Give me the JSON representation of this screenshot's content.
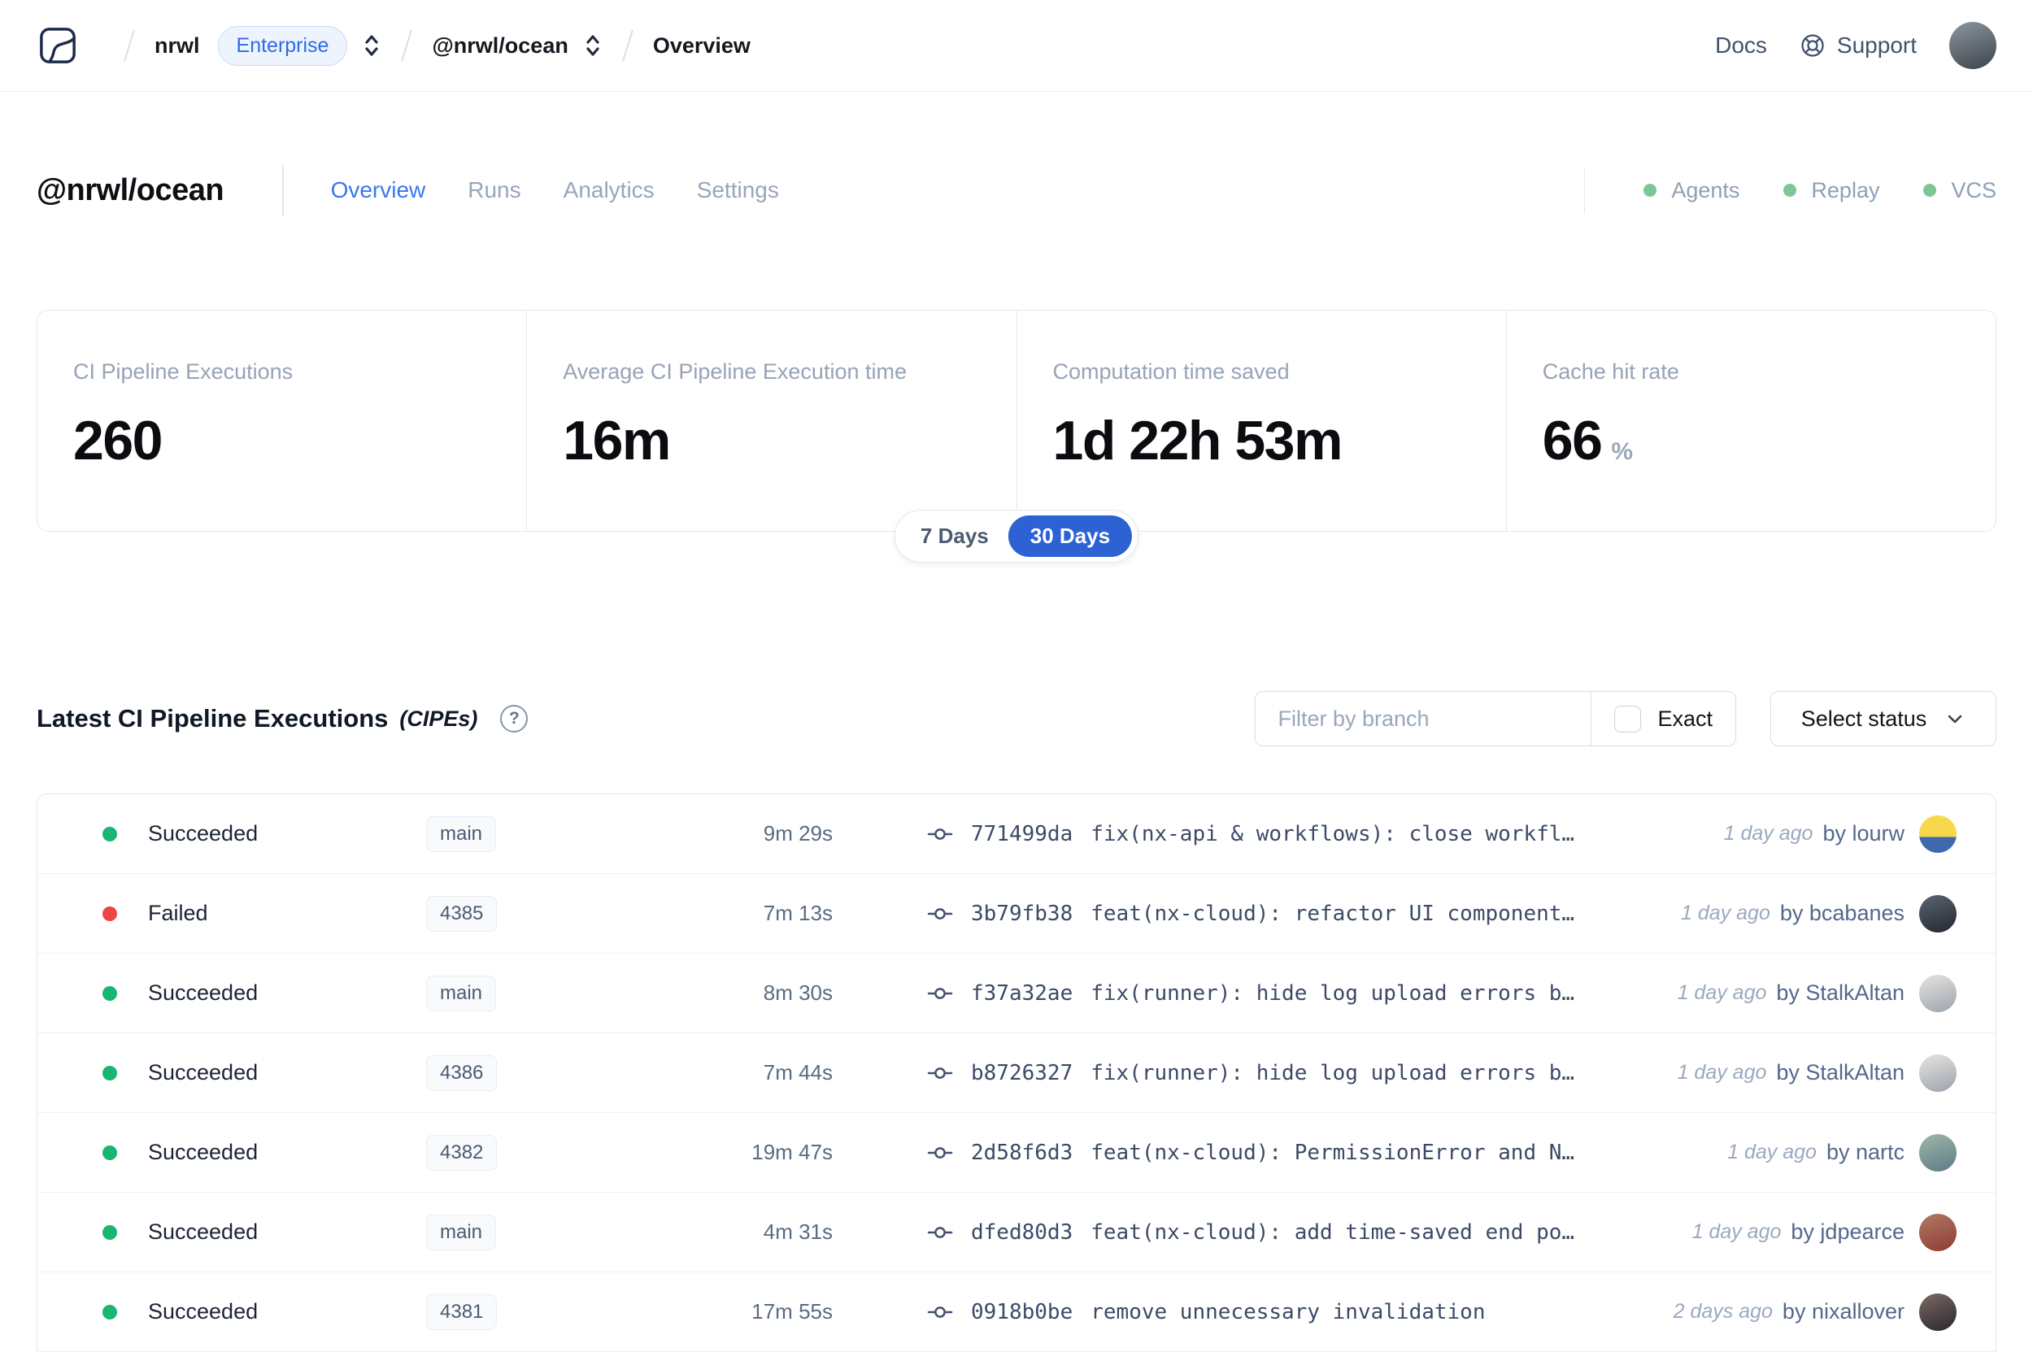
{
  "navbar": {
    "breadcrumb": {
      "org": "nrwl",
      "org_badge": "Enterprise",
      "workspace": "@nrwl/ocean",
      "page": "Overview"
    },
    "docs_label": "Docs",
    "support_label": "Support",
    "avatar_colors": [
      "#8d979f",
      "#3c434a"
    ]
  },
  "header": {
    "title": "@nrwl/ocean",
    "tabs": [
      {
        "label": "Overview",
        "active": true
      },
      {
        "label": "Runs",
        "active": false
      },
      {
        "label": "Analytics",
        "active": false
      },
      {
        "label": "Settings",
        "active": false
      }
    ],
    "integrations": [
      {
        "label": "Agents",
        "status": "online"
      },
      {
        "label": "Replay",
        "status": "online"
      },
      {
        "label": "VCS",
        "status": "online"
      }
    ]
  },
  "stats": {
    "cards": [
      {
        "label": "CI Pipeline Executions",
        "value": "260",
        "suffix": ""
      },
      {
        "label": "Average CI Pipeline Execution time",
        "value": "16m",
        "suffix": ""
      },
      {
        "label": "Computation time saved",
        "value": "1d 22h 53m",
        "suffix": ""
      },
      {
        "label": "Cache hit rate",
        "value": "66",
        "suffix": "%"
      }
    ],
    "range_options": [
      {
        "label": "7 Days",
        "selected": false
      },
      {
        "label": "30 Days",
        "selected": true
      }
    ]
  },
  "cipes": {
    "title": "Latest CI Pipeline Executions",
    "title_suffix": "(CIPEs)",
    "help_icon": "?",
    "filter_placeholder": "Filter by branch",
    "exact_label": "Exact",
    "exact_checked": false,
    "status_select_label": "Select status",
    "rows": [
      {
        "status": "Succeeded",
        "status_key": "succeeded",
        "branch": "main",
        "duration": "9m 29s",
        "commit_sha": "771499da",
        "commit_message": "fix(nx-api & workflows): close workfl…",
        "time_ago": "1 day ago",
        "author": "by lourw",
        "avatar_colors": [
          "#f7d84b",
          "#4068ae"
        ],
        "avatar_split": 58
      },
      {
        "status": "Failed",
        "status_key": "failed",
        "branch": "4385",
        "duration": "7m 13s",
        "commit_sha": "3b79fb38",
        "commit_message": "feat(nx-cloud): refactor UI component…",
        "time_ago": "1 day ago",
        "author": "by bcabanes",
        "avatar_colors": [
          "#5b6571",
          "#23272e"
        ],
        "avatar_split": null
      },
      {
        "status": "Succeeded",
        "status_key": "succeeded",
        "branch": "main",
        "duration": "8m 30s",
        "commit_sha": "f37a32ae",
        "commit_message": "fix(runner): hide log upload errors b…",
        "time_ago": "1 day ago",
        "author": "by StalkAltan",
        "avatar_colors": [
          "#e8e4e0",
          "#9aa4ad"
        ],
        "avatar_split": null
      },
      {
        "status": "Succeeded",
        "status_key": "succeeded",
        "branch": "4386",
        "duration": "7m 44s",
        "commit_sha": "b8726327",
        "commit_message": "fix(runner): hide log upload errors b…",
        "time_ago": "1 day ago",
        "author": "by StalkAltan",
        "avatar_colors": [
          "#e8e4e0",
          "#9aa4ad"
        ],
        "avatar_split": null
      },
      {
        "status": "Succeeded",
        "status_key": "succeeded",
        "branch": "4382",
        "duration": "19m 47s",
        "commit_sha": "2d58f6d3",
        "commit_message": "feat(nx-cloud): PermissionError and N…",
        "time_ago": "1 day ago",
        "author": "by nartc",
        "avatar_colors": [
          "#9fb7a8",
          "#5f7a86"
        ],
        "avatar_split": null
      },
      {
        "status": "Succeeded",
        "status_key": "succeeded",
        "branch": "main",
        "duration": "4m 31s",
        "commit_sha": "dfed80d3",
        "commit_message": "feat(nx-cloud): add time-saved end po…",
        "time_ago": "1 day ago",
        "author": "by jdpearce",
        "avatar_colors": [
          "#b07a63",
          "#8f3b33"
        ],
        "avatar_split": null
      },
      {
        "status": "Succeeded",
        "status_key": "succeeded",
        "branch": "4381",
        "duration": "17m 55s",
        "commit_sha": "0918b0be",
        "commit_message": "remove unnecessary invalidation",
        "time_ago": "2 days ago",
        "author": "by nixallover",
        "avatar_colors": [
          "#7a6a62",
          "#2c2730"
        ],
        "avatar_split": null
      }
    ]
  },
  "colors": {
    "succeeded": "#18b573",
    "failed": "#ee4444",
    "accent_blue": "#2d62d4",
    "tab_active_blue": "#3b76f0",
    "enterprise_blue": "#2e6be0",
    "integration_green": "#7cc795"
  }
}
